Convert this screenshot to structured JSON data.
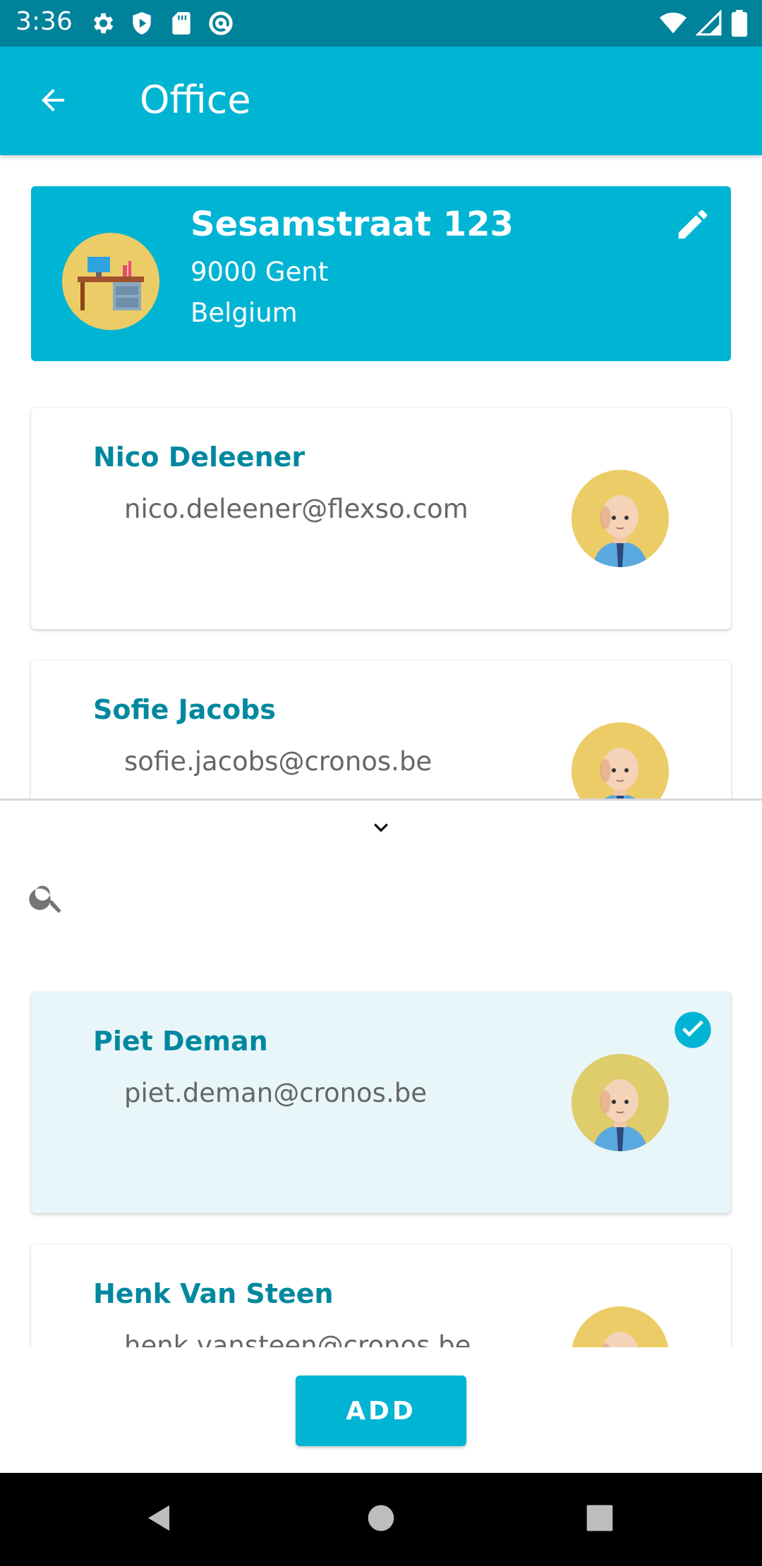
{
  "status_bar": {
    "time": "3:36",
    "left_icons": [
      "settings-icon",
      "shield-play-icon",
      "sd-card-icon",
      "at-sign-icon"
    ],
    "right_icons": [
      "wifi-icon",
      "signal-icon",
      "battery-icon"
    ]
  },
  "app_bar": {
    "title": "Office",
    "back_icon": "arrow-left-icon",
    "color": "#00b4d4"
  },
  "office": {
    "street": "Sesamstraat 123",
    "city": "9000 Gent",
    "country": "Belgium",
    "edit_icon": "pencil-icon"
  },
  "assigned_people": [
    {
      "name": "Nico Deleener",
      "email": "nico.deleener@flexso.com"
    },
    {
      "name": "Sofie Jacobs",
      "email": "sofie.jacobs@cronos.be"
    }
  ],
  "picker": {
    "collapse_icon": "chevron-down-icon",
    "search": {
      "value": "",
      "placeholder": ""
    },
    "people": [
      {
        "name": "Piet Deman",
        "email": "piet.deman@cronos.be",
        "selected": true
      },
      {
        "name": "Henk Van Steen",
        "email": "henk.vansteen@cronos.be",
        "selected": false
      }
    ],
    "add_label": "ADD"
  },
  "nav_bar": {
    "icons": [
      "back-triangle-icon",
      "home-circle-icon",
      "recents-square-icon"
    ]
  },
  "colors": {
    "accent": "#00b4d4",
    "name_text": "#00889f",
    "selected_bg": "#e8f6fa",
    "avatar_bg": "#eccc66"
  }
}
